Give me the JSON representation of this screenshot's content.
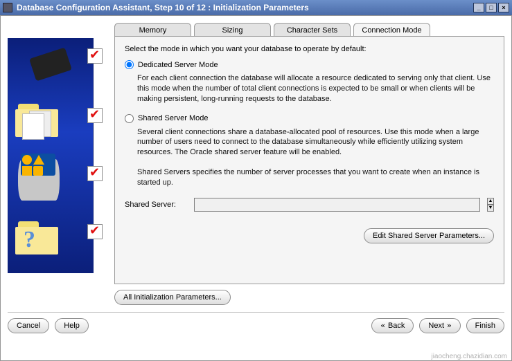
{
  "window": {
    "title": "Database Configuration Assistant, Step 10 of 12 : Initialization Parameters"
  },
  "tabs": {
    "memory": "Memory",
    "sizing": "Sizing",
    "charsets": "Character Sets",
    "connmode": "Connection Mode"
  },
  "panel": {
    "intro": "Select the mode in which you want your database to operate by default:",
    "dedicated": {
      "label": "Dedicated Server Mode",
      "desc": "For each client connection the database will allocate a resource dedicated to serving only that client.  Use this mode when the number of total client connections is expected to be small or when clients will be making persistent, long-running requests to the database."
    },
    "shared": {
      "label": "Shared Server Mode",
      "desc": "Several client connections share a database-allocated pool of resources.  Use this mode when a large number of users need to connect to the database simultaneously while efficiently utilizing system resources.  The Oracle shared server feature will be enabled.",
      "desc2": "Shared Servers specifies the number of server processes that you want to create when an instance is started up.",
      "field_label": "Shared Server:",
      "field_value": ""
    },
    "edit_params_btn": "Edit Shared Server Parameters...",
    "all_params_btn": "All Initialization Parameters..."
  },
  "footer": {
    "cancel": "Cancel",
    "help": "Help",
    "back": "Back",
    "next": "Next",
    "finish": "Finish"
  },
  "watermark": "jiaocheng.chazidian.com"
}
